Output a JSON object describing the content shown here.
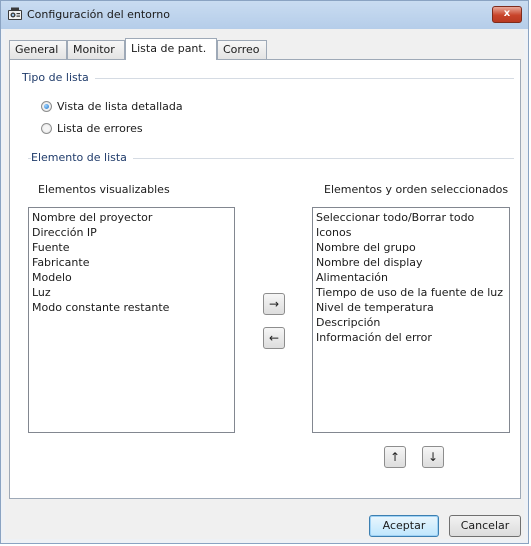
{
  "window": {
    "title": "Configuración del entorno",
    "close_glyph": "x"
  },
  "tabs": [
    {
      "label": "General",
      "active": false
    },
    {
      "label": "Monitor",
      "active": false
    },
    {
      "label": "Lista de pant.",
      "active": true
    },
    {
      "label": "Correo",
      "active": false
    }
  ],
  "list_type": {
    "group_label": "Tipo de lista",
    "options": [
      {
        "label": "Vista de lista detallada",
        "selected": true
      },
      {
        "label": "Lista de errores",
        "selected": false
      }
    ]
  },
  "list_element": {
    "group_label": "Elemento de lista",
    "available_header": "Elementos visualizables",
    "selected_header": "Elementos y orden seleccionados",
    "available_items": [
      "Nombre del proyector",
      "Dirección IP",
      "Fuente",
      "Fabricante",
      "Modelo",
      "Luz",
      "Modo constante restante"
    ],
    "selected_items": [
      "Seleccionar todo/Borrar todo",
      "Iconos",
      "Nombre del grupo",
      "Nombre del display",
      "Alimentación",
      "Tiempo de uso de la fuente de luz",
      "Nivel de temperatura",
      "Descripción",
      "Información del error"
    ],
    "add_glyph": "→",
    "remove_glyph": "←",
    "up_glyph": "↑",
    "down_glyph": "↓"
  },
  "buttons": {
    "ok": "Aceptar",
    "cancel": "Cancelar"
  },
  "colors": {
    "titlebar": "#b5cde9",
    "group_title": "#1f3b6a",
    "close_button": "#c8442b"
  }
}
